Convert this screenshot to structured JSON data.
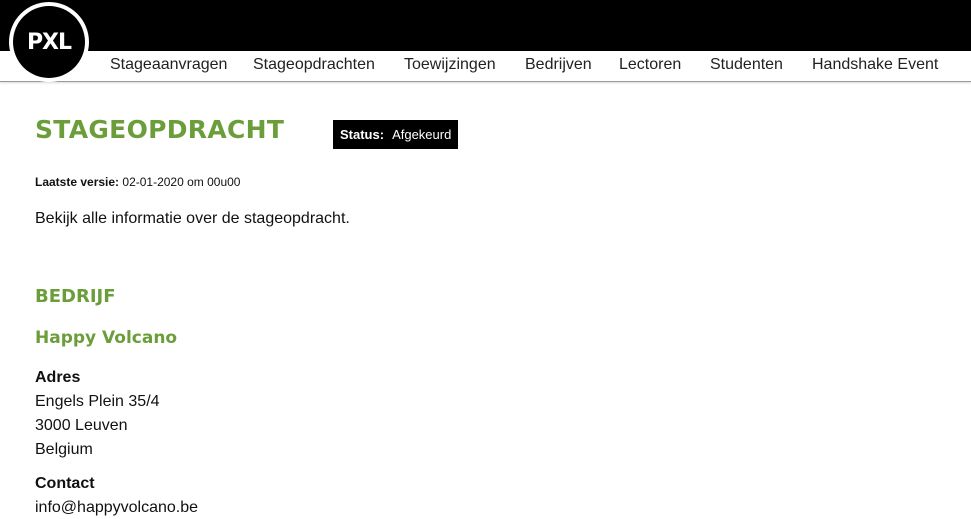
{
  "logo": {
    "text": "PXL"
  },
  "nav": {
    "items": [
      {
        "label": "Stageaanvragen"
      },
      {
        "label": "Stageopdrachten"
      },
      {
        "label": "Toewijzingen"
      },
      {
        "label": "Bedrijven"
      },
      {
        "label": "Lectoren"
      },
      {
        "label": "Studenten"
      },
      {
        "label": "Handshake Event"
      }
    ]
  },
  "page": {
    "title": "STAGEOPDRACHT",
    "status_label": "Status:",
    "status_value": "Afgekeurd",
    "version_label": "Laatste versie:",
    "version_value": "02-01-2020 om 00u00",
    "intro": "Bekijk alle informatie over de stageopdracht."
  },
  "company": {
    "section_title": "BEDRIJF",
    "name": "Happy Volcano",
    "address_label": "Adres",
    "address_lines": [
      "Engels Plein 35/4",
      "3000 Leuven",
      "Belgium"
    ],
    "contact_label": "Contact",
    "contact_email": "info@happyvolcano.be"
  },
  "colors": {
    "accent_green": "#6b9e3a",
    "header_black": "#000000",
    "status_badge_bg": "#000000"
  }
}
